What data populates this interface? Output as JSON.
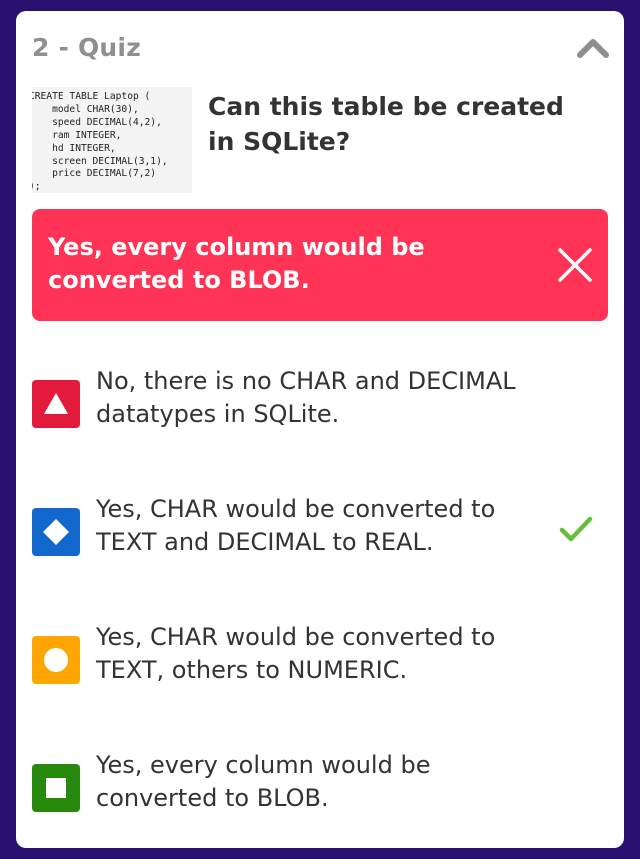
{
  "header": {
    "title": "2 - Quiz",
    "collapse_icon": "chevron-up-icon"
  },
  "question": {
    "code_lines": [
      "CREATE TABLE Laptop (",
      "    model CHAR(30),",
      "    speed DECIMAL(4,2),",
      "    ram INTEGER,",
      "    hd INTEGER,",
      "    screen DECIMAL(3,1),",
      "    price DECIMAL(7,2)",
      ");"
    ],
    "text": "Can this table be created in SQLite?"
  },
  "selected_answer": {
    "text": "Yes, every column would be converted to BLOB.",
    "status": "incorrect",
    "color": "#ff3355",
    "icon": "close-icon"
  },
  "options": [
    {
      "shape": "triangle",
      "color": "#e21b3c",
      "label": "No, there is no CHAR and DECIMAL datatypes in SQLite.",
      "correct": false
    },
    {
      "shape": "diamond",
      "color": "#1368ce",
      "label": "Yes, CHAR would be converted to TEXT and DECIMAL to REAL.",
      "correct": true
    },
    {
      "shape": "circle",
      "color": "#ffa602",
      "label": "Yes, CHAR would be converted to TEXT, others to NUMERIC.",
      "correct": false
    },
    {
      "shape": "square",
      "color": "#26890c",
      "label": "Yes, every column would be converted to BLOB.",
      "correct": false
    }
  ],
  "colors": {
    "background": "#2a1070",
    "correct_check": "#66bf39"
  }
}
